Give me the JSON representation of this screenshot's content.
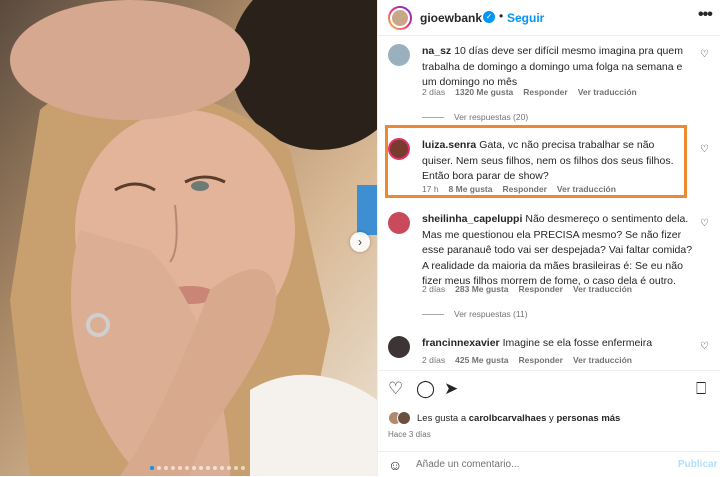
{
  "post": {
    "username": "gioewbank",
    "follow_label": "Seguir",
    "more_glyph": "•••",
    "verified_glyph": "✓",
    "separator": "•"
  },
  "comments": [
    {
      "user": "na_sz",
      "text": "10 días deve ser difícil mesmo imagina pra quem trabalha de domingo a domingo uma folga na semana e um domingo no mês",
      "time": "2 días",
      "likes": "1320 Me gusta",
      "reply": "Responder",
      "translate": "Ver traducción",
      "replies": "Ver respuestas (20)"
    },
    {
      "user": "luiza.senra",
      "text": "Gata, vc não precisa trabalhar se não quiser. Nem seus filhos, nem os filhos dos seus filhos. Então bora parar de show?",
      "time": "17 h",
      "likes": "8 Me gusta",
      "reply": "Responder",
      "translate": "Ver traducción"
    },
    {
      "user": "sheilinha_capeluppi",
      "text": "Não desmereço o sentimento dela. Mas me questionou ela PRECISA mesmo? Se não fizer esse paranauê todo vai ser despejada? Vai faltar comida? A realidade da maioria da mães brasileiras é: Se eu não fizer meus filhos morrem de fome, o caso dela é outro.",
      "time": "2 días",
      "likes": "283 Me gusta",
      "reply": "Responder",
      "translate": "Ver traducción",
      "replies": "Ver respuestas (11)"
    },
    {
      "user": "francinnexavier",
      "text": "Imagine se ela fosse enfermeira",
      "time": "2 días",
      "likes": "425 Me gusta",
      "reply": "Responder",
      "translate": "Ver traducción"
    }
  ],
  "footer": {
    "likes_prefix": "Les gusta a",
    "likes_user": "carolbcarvalhaes",
    "likes_mid": "y",
    "likes_others": "personas más",
    "ago": "Hace 3 días",
    "add_placeholder": "Añade un comentario...",
    "publish": "Publicar"
  },
  "icons": {
    "heart": "♡",
    "comment": "◯",
    "share": "➤",
    "save": "⎕",
    "emoji": "☺",
    "next": "›"
  },
  "colors": {
    "accent": "#0095f6",
    "highlight_box": "#ed8a2f"
  }
}
